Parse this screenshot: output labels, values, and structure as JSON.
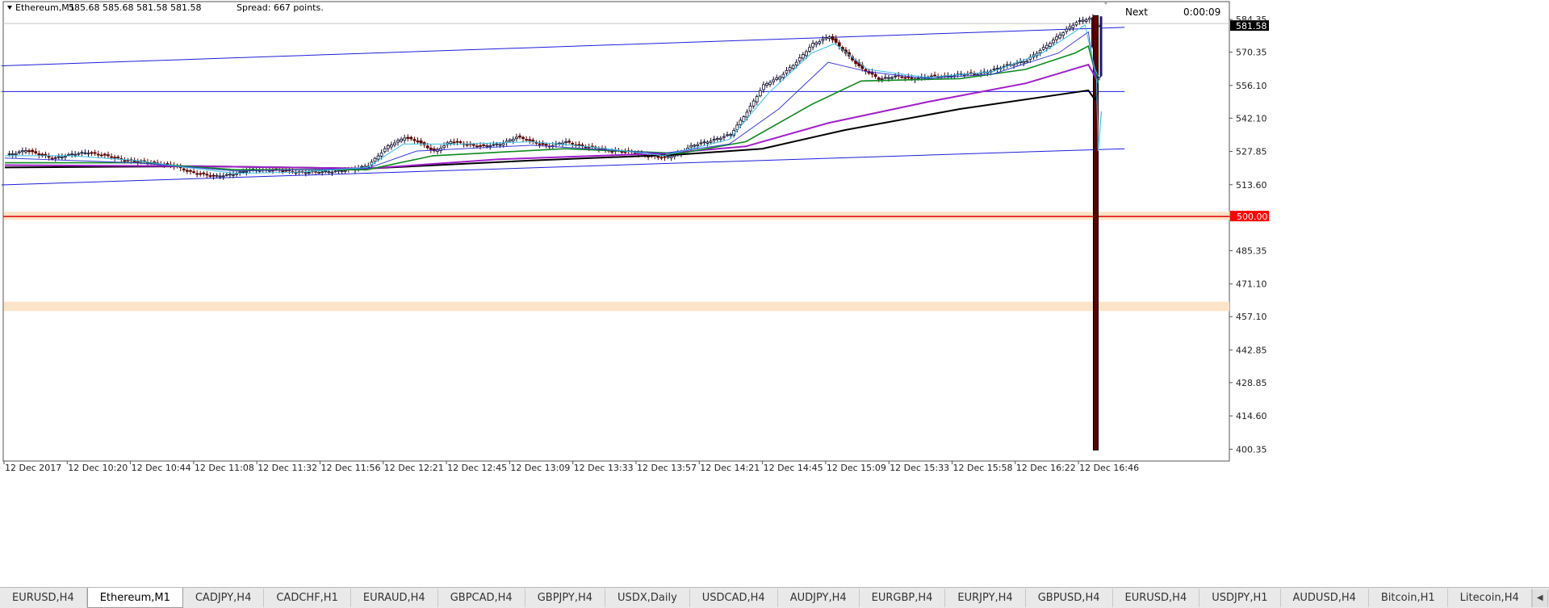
{
  "chart_data": {
    "type": "candlestick",
    "symbol": "Ethereum,M1",
    "ohlc_header": "585.68 585.68 581.58 581.58",
    "spread": "Spread: 667 points.",
    "next_label": "Next",
    "timer": "0:00:09",
    "current_price": "581.58",
    "level_label": "500.00",
    "ylim": [
      397.0,
      592.0
    ],
    "y_ticks": [
      "584.35",
      "570.35",
      "556.10",
      "542.10",
      "527.85",
      "513.60",
      "500.00",
      "485.35",
      "471.10",
      "457.10",
      "442.85",
      "428.85",
      "414.60",
      "400.35"
    ],
    "x_ticks": [
      "12 Dec 2017",
      "12 Dec 10:20",
      "12 Dec 10:44",
      "12 Dec 11:08",
      "12 Dec 11:32",
      "12 Dec 11:56",
      "12 Dec 12:21",
      "12 Dec 12:45",
      "12 Dec 13:09",
      "12 Dec 13:33",
      "12 Dec 13:57",
      "12 Dec 14:21",
      "12 Dec 14:45",
      "12 Dec 15:09",
      "12 Dec 15:33",
      "12 Dec 15:58",
      "12 Dec 16:22",
      "12 Dec 16:46"
    ],
    "close_series": [
      [
        0,
        526.0
      ],
      [
        6,
        528.5
      ],
      [
        10,
        526.5
      ],
      [
        14,
        525.0
      ],
      [
        20,
        526.5
      ],
      [
        25,
        527.5
      ],
      [
        30,
        526.0
      ],
      [
        35,
        524.5
      ],
      [
        40,
        523.5
      ],
      [
        45,
        523.0
      ],
      [
        50,
        522.0
      ],
      [
        55,
        519.5
      ],
      [
        60,
        518.0
      ],
      [
        63,
        517.0
      ],
      [
        70,
        518.5
      ],
      [
        75,
        520.0
      ],
      [
        80,
        520.0
      ],
      [
        85,
        519.5
      ],
      [
        90,
        519.0
      ],
      [
        95,
        519.0
      ],
      [
        100,
        519.5
      ],
      [
        105,
        520.0
      ],
      [
        110,
        522.0
      ],
      [
        116,
        530.0
      ],
      [
        121,
        534.0
      ],
      [
        125,
        532.0
      ],
      [
        130,
        528.0
      ],
      [
        135,
        532.0
      ],
      [
        140,
        531.0
      ],
      [
        145,
        530.0
      ],
      [
        150,
        531.0
      ],
      [
        155,
        534.0
      ],
      [
        160,
        532.0
      ],
      [
        165,
        530.0
      ],
      [
        170,
        532.0
      ],
      [
        175,
        530.0
      ],
      [
        180,
        529.0
      ],
      [
        185,
        528.0
      ],
      [
        190,
        527.5
      ],
      [
        195,
        526.0
      ],
      [
        200,
        525.0
      ],
      [
        204,
        527.0
      ],
      [
        208,
        530.0
      ],
      [
        215,
        533.0
      ],
      [
        220,
        535.0
      ],
      [
        225,
        545.0
      ],
      [
        230,
        556.0
      ],
      [
        235,
        560.0
      ],
      [
        240,
        566.0
      ],
      [
        245,
        574.0
      ],
      [
        250,
        577.0
      ],
      [
        255,
        570.0
      ],
      [
        260,
        563.0
      ],
      [
        265,
        559.0
      ],
      [
        270,
        560.0
      ],
      [
        275,
        559.0
      ],
      [
        280,
        560.0
      ],
      [
        285,
        560.0
      ],
      [
        290,
        561.0
      ],
      [
        295,
        561.0
      ],
      [
        300,
        563.0
      ],
      [
        305,
        565.0
      ],
      [
        310,
        567.0
      ],
      [
        315,
        572.0
      ],
      [
        320,
        578.0
      ],
      [
        325,
        583.0
      ],
      [
        329,
        585.0
      ],
      [
        331,
        560.0
      ],
      [
        332,
        581.58
      ]
    ],
    "spike": {
      "bar": 331,
      "high": 586.0,
      "low": 400.0,
      "close": 562.0
    },
    "ema_fast_series": [
      [
        0,
        526.0
      ],
      [
        20,
        526.0
      ],
      [
        40,
        524.0
      ],
      [
        55,
        521.0
      ],
      [
        70,
        518.5
      ],
      [
        90,
        519.0
      ],
      [
        110,
        521.0
      ],
      [
        121,
        531.0
      ],
      [
        140,
        531.0
      ],
      [
        160,
        532.0
      ],
      [
        180,
        529.5
      ],
      [
        200,
        526.0
      ],
      [
        220,
        533.0
      ],
      [
        232,
        553.0
      ],
      [
        245,
        570.0
      ],
      [
        252,
        574.0
      ],
      [
        262,
        563.0
      ],
      [
        280,
        559.5
      ],
      [
        300,
        562.0
      ],
      [
        315,
        570.0
      ],
      [
        328,
        582.0
      ],
      [
        331,
        563.0
      ],
      [
        332,
        560.0
      ]
    ],
    "ema_mid_series": [
      [
        0,
        525.0
      ],
      [
        40,
        523.0
      ],
      [
        70,
        519.5
      ],
      [
        110,
        520.5
      ],
      [
        125,
        528.0
      ],
      [
        160,
        530.5
      ],
      [
        200,
        527.0
      ],
      [
        220,
        531.0
      ],
      [
        235,
        546.0
      ],
      [
        250,
        566.0
      ],
      [
        262,
        562.0
      ],
      [
        280,
        559.0
      ],
      [
        300,
        561.0
      ],
      [
        320,
        570.0
      ],
      [
        329,
        579.0
      ],
      [
        331,
        560.0
      ],
      [
        332,
        559.0
      ]
    ],
    "ema_green_series": [
      [
        0,
        523.0
      ],
      [
        40,
        523.0
      ],
      [
        70,
        520.0
      ],
      [
        110,
        520.0
      ],
      [
        130,
        526.0
      ],
      [
        170,
        529.0
      ],
      [
        205,
        527.0
      ],
      [
        225,
        532.0
      ],
      [
        245,
        548.0
      ],
      [
        260,
        558.0
      ],
      [
        290,
        559.0
      ],
      [
        310,
        563.0
      ],
      [
        325,
        570.0
      ],
      [
        329,
        573.0
      ],
      [
        331,
        562.0
      ],
      [
        332,
        557.0
      ]
    ],
    "ema_purple_series": [
      [
        0,
        522.0
      ],
      [
        60,
        521.5
      ],
      [
        110,
        520.5
      ],
      [
        150,
        524.5
      ],
      [
        200,
        527.0
      ],
      [
        225,
        530.0
      ],
      [
        250,
        540.0
      ],
      [
        280,
        549.0
      ],
      [
        310,
        557.0
      ],
      [
        329,
        565.0
      ],
      [
        331,
        560.0
      ],
      [
        332,
        557.5
      ]
    ],
    "ema_black_series": [
      [
        0,
        521.0
      ],
      [
        60,
        521.5
      ],
      [
        110,
        520.5
      ],
      [
        160,
        524.0
      ],
      [
        205,
        526.5
      ],
      [
        230,
        529.0
      ],
      [
        255,
        537.0
      ],
      [
        290,
        546.0
      ],
      [
        329,
        554.0
      ],
      [
        331,
        550.0
      ],
      [
        332,
        553.0
      ]
    ],
    "trendlines": [
      {
        "name": "upper-channel",
        "p1": [
          -1,
          564.5
        ],
        "p2": [
          340,
          581.0
        ]
      },
      {
        "name": "lower-channel",
        "p1": [
          -1,
          513.5
        ],
        "p2": [
          340,
          529.0
        ]
      },
      {
        "name": "horizontal-level",
        "p1": [
          -1,
          553.5
        ],
        "p2": [
          340,
          553.5
        ]
      }
    ],
    "zones": [
      {
        "name": "upper-supply-zone",
        "from": 498.5,
        "to": 502.0
      },
      {
        "name": "lower-supply-zone",
        "from": 459.5,
        "to": 463.5
      }
    ],
    "colors": {
      "background": "#ffffff",
      "bull_candle": "#0a0a2a",
      "bear_candle": "#5a0000",
      "trendline": "#1e1edc",
      "level_line": "#e00000",
      "zone_fill": "#fde4c8",
      "ema_fast": "#35c1e6",
      "ema_mid": "#3b3bd8",
      "ema_green": "#0c8a1f",
      "ema_purple": "#a01ec9",
      "ema_black": "#000000",
      "axis_text": "#222222",
      "price_tag_bg": "#000000",
      "level_tag_bg": "#ff0000"
    }
  },
  "tabs": {
    "items": [
      "EURUSD,H4",
      "Ethereum,M1",
      "CADJPY,H4",
      "CADCHF,H1",
      "EURAUD,H4",
      "GBPCAD,H4",
      "GBPJPY,H4",
      "USDX,Daily",
      "USDCAD,H4",
      "AUDJPY,H4",
      "EURGBP,H4",
      "EURJPY,H4",
      "GBPUSD,H4",
      "EURUSD,H4",
      "USDJPY,H1",
      "AUDUSD,H4",
      "Bitcoin,H1",
      "Litecoin,H4"
    ],
    "active_index": 1
  }
}
